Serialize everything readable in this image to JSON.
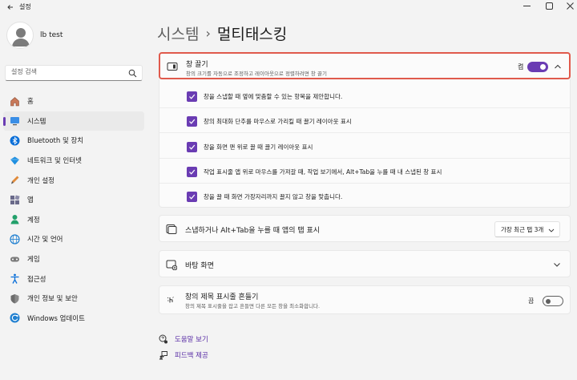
{
  "window": {
    "title": "설정"
  },
  "profile": {
    "name": "lb test"
  },
  "search": {
    "placeholder": "설정 검색"
  },
  "sidebar": {
    "items": [
      {
        "label": "홈",
        "icon": "home-icon"
      },
      {
        "label": "시스템",
        "icon": "system-icon",
        "active": true
      },
      {
        "label": "Bluetooth 및 장치",
        "icon": "bluetooth-icon"
      },
      {
        "label": "네트워크 및 인터넷",
        "icon": "network-icon"
      },
      {
        "label": "개인 설정",
        "icon": "personalization-icon"
      },
      {
        "label": "앱",
        "icon": "apps-icon"
      },
      {
        "label": "계정",
        "icon": "accounts-icon"
      },
      {
        "label": "시간 및 언어",
        "icon": "time-language-icon"
      },
      {
        "label": "게임",
        "icon": "gaming-icon"
      },
      {
        "label": "접근성",
        "icon": "accessibility-icon"
      },
      {
        "label": "개인 정보 및 보안",
        "icon": "privacy-shield-icon"
      },
      {
        "label": "Windows 업데이트",
        "icon": "windows-update-icon"
      }
    ]
  },
  "breadcrumb": {
    "parent": "시스템",
    "separator": "›",
    "current": "멀티태스킹"
  },
  "snap": {
    "title": "창 끌기",
    "subtitle": "창의 크기를 자동으로 조정하고 레이아웃으로 정렬하려면 창 끌기",
    "toggle_label": "켬",
    "toggle_on": true,
    "options": [
      {
        "label": "창을 스냅할 때 옆에 맞춤할 수 있는 항목을 제안합니다.",
        "checked": true
      },
      {
        "label": "창의 최대화 단추를 마우스로 가리킬 때 끌기 레이아웃 표시",
        "checked": true
      },
      {
        "label": "창을 화면 맨 위로 끌 때 끌기 레이아웃 표시",
        "checked": true
      },
      {
        "label": "작업 표시줄 앱 위로 마우스를 가져갈 때, 작업 보기에서, Alt+Tab을 누를 때 내 스냅된 창 표시",
        "checked": true
      },
      {
        "label": "창을 끌 때 화면 가장자리까지 끌지 않고 창을 맞춥니다.",
        "checked": true
      }
    ]
  },
  "alt_tab": {
    "title": "스냅하거나 Alt+Tab을 누를 때 앱의 탭 표시",
    "selected": "가장 최근 탭 3개"
  },
  "desktop": {
    "title": "바탕 화면"
  },
  "shake": {
    "title": "창의 제목 표시줄 흔들기",
    "subtitle": "창의 제목 표시줄을 잡고 흔들면 다른 모든 창을 최소화합니다.",
    "toggle_label": "끔",
    "toggle_on": false
  },
  "links": {
    "help": "도움말 보기",
    "feedback": "피드백 제공"
  },
  "colors": {
    "accent": "#6a3cb3",
    "highlight_border": "#e05a4c"
  }
}
